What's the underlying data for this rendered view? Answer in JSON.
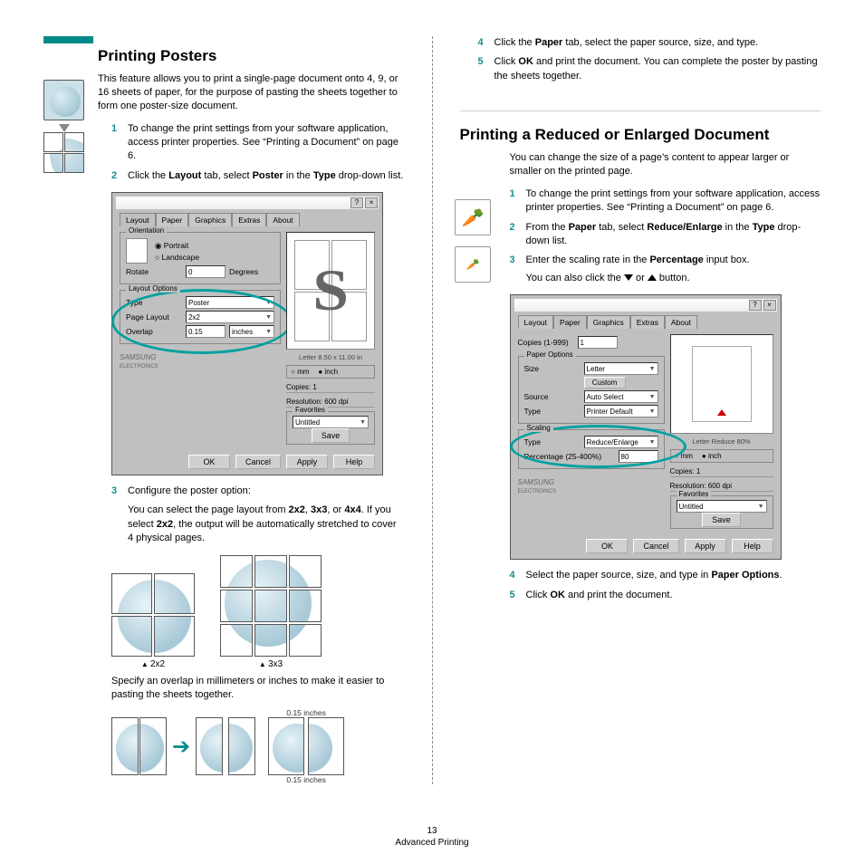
{
  "footer": {
    "pageNum": "13",
    "section": "Advanced Printing"
  },
  "left": {
    "heading": "Printing Posters",
    "intro": "This feature allows you to print a single-page document onto 4, 9, or 16 sheets of paper, for the purpose of pasting the sheets together to form one poster-size document.",
    "steps": {
      "s1": "To change the print settings from your software application, access printer properties. See “Printing a Document” on page 6.",
      "s2a": "Click the ",
      "s2b": "Layout",
      "s2c": " tab, select ",
      "s2d": "Poster",
      "s2e": " in the ",
      "s2f": "Type",
      "s2g": " drop-down list.",
      "s3a": "Configure the poster option:",
      "s3b": "You can select the page layout from ",
      "s3c": "2x2",
      "s3d": ", ",
      "s3e": "3x3",
      "s3f": ", or ",
      "s3g": "4x4",
      "s3h": ". If you select ",
      "s3i": "2x2",
      "s3j": ", the output will be automatically stretched to cover 4 physical pages.",
      "cap22": "2x2",
      "cap33": "3x3",
      "s3k": "Specify an overlap in millimeters or inches to make it easier to pasting the sheets together.",
      "dim": "0.15 inches",
      "s4a": "Click the ",
      "s4b": "Paper",
      "s4c": " tab, select the paper source, size, and type.",
      "s5a": "Click ",
      "s5b": "OK",
      "s5c": " and print the document. You can complete the poster by pasting the sheets together."
    },
    "dialog": {
      "tabs": [
        "Layout",
        "Paper",
        "Graphics",
        "Extras",
        "About"
      ],
      "orientation": "Orientation",
      "portrait": "Portrait",
      "landscape": "Landscape",
      "rotate": "Rotate",
      "rotateVal": "0",
      "degrees": "Degrees",
      "layoutOptions": "Layout Options",
      "type": "Type",
      "typeVal": "Poster",
      "pageLayout": "Page Layout",
      "pageLayoutVal": "2x2",
      "overlap": "Overlap",
      "overlapVal": "0.15",
      "inches": "inches",
      "previewLabel": "Letter\n8.50 x 11.00 in",
      "mm": "mm",
      "inch": "inch",
      "copies": "Copies: 1",
      "resolution": "Resolution: 600 dpi",
      "favorites": "Favorites",
      "untitled": "Untitled",
      "save": "Save",
      "brand": "SAMSUNG",
      "brandSub": "ELECTRONICS",
      "ok": "OK",
      "cancel": "Cancel",
      "apply": "Apply",
      "help": "Help"
    }
  },
  "right": {
    "heading": "Printing a Reduced or Enlarged Document",
    "intro": "You can change the size of a page’s content to appear larger or smaller on the printed page.",
    "steps": {
      "s1": "To change the print settings from your software application, access printer properties. See “Printing a Document” on page 6.",
      "s2a": "From the ",
      "s2b": "Paper",
      "s2c": " tab, select ",
      "s2d": "Reduce/Enlarge",
      "s2e": " in the ",
      "s2f": "Type",
      "s2g": " drop-down list.",
      "s3a": "Enter the scaling rate in the ",
      "s3b": "Percentage",
      "s3c": " input box.",
      "s3d": "You can also click the ",
      "s3e": " or ",
      "s3f": " button.",
      "s4a": "Select the paper source, size, and type in ",
      "s4b": "Paper Options",
      "s4c": ".",
      "s5a": "Click ",
      "s5b": "OK",
      "s5c": " and print the document."
    },
    "dialog": {
      "tabs": [
        "Layout",
        "Paper",
        "Graphics",
        "Extras",
        "About"
      ],
      "copiesLabel": "Copies (1-999)",
      "copiesVal": "1",
      "paperOptions": "Paper Options",
      "size": "Size",
      "sizeVal": "Letter",
      "custom": "Custom",
      "source": "Source",
      "sourceVal": "Auto Select",
      "type": "Type",
      "typeVal": "Printer Default",
      "scaling": "Scaling",
      "scaleType": "Type",
      "scaleTypeVal": "Reduce/Enlarge",
      "pct": "Percentage (25-400%)",
      "pctVal": "80",
      "previewLabel": "Letter\nReduce 80%",
      "mm": "mm",
      "inch": "inch",
      "copies": "Copies: 1",
      "resolution": "Resolution: 600 dpi",
      "favorites": "Favorites",
      "untitled": "Untitled",
      "save": "Save",
      "brand": "SAMSUNG",
      "brandSub": "ELECTRONICS",
      "ok": "OK",
      "cancel": "Cancel",
      "apply": "Apply",
      "help": "Help"
    }
  }
}
